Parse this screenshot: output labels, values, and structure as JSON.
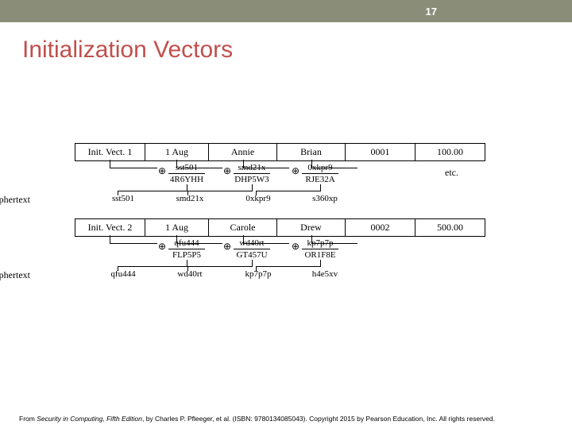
{
  "slide_number": "17",
  "title": "Initialization Vectors",
  "block1": {
    "row": [
      "Init. Vect. 1",
      "1 Aug",
      "Annie",
      "Brian",
      "0001",
      "100.00"
    ],
    "f1": {
      "top": "sst501",
      "bot": "4R6YHH"
    },
    "f2": {
      "top": "smd21x",
      "bot": "DHP5W3"
    },
    "f3": {
      "top": "0xkpr9",
      "bot": "RJE32A"
    },
    "etc": "etc.",
    "ciph_label": "ciphertext",
    "ciph": [
      "sst501",
      "smd21x",
      "0xkpr9",
      "s360xp"
    ]
  },
  "block2": {
    "row": [
      "Init. Vect. 2",
      "1 Aug",
      "Carole",
      "Drew",
      "0002",
      "500.00"
    ],
    "f1": {
      "top": "qfu444",
      "bot": "FLP5P5"
    },
    "f2": {
      "top": "wd40rt",
      "bot": "GT457U"
    },
    "f3": {
      "top": "kp7p7p",
      "bot": "OR1F8E"
    },
    "ciph_label": "ciphertext",
    "ciph": [
      "qfu444",
      "wd40rt",
      "kp7p7p",
      "h4e5xv"
    ]
  },
  "footer": {
    "pre": "From ",
    "book": "Security in Computing, Fifth Edition",
    "post": ", by Charles P. Pfleeger, et al. (ISBN: 9780134085043). Copyright 2015 by Pearson Education, Inc. All rights reserved."
  }
}
